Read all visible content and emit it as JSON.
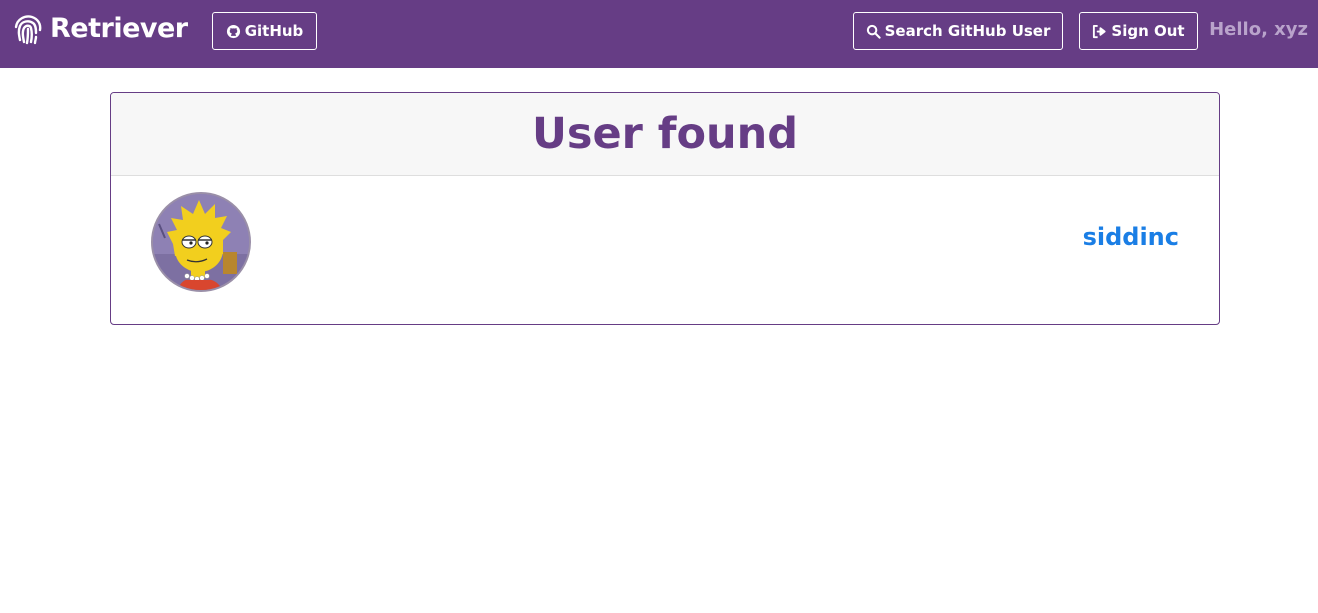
{
  "navbar": {
    "brand": "Retriever",
    "brand_icon": "fingerprint-icon",
    "github_label": "GitHub",
    "github_icon": "github-icon",
    "search_label": "Search GitHub User",
    "search_icon": "search-icon",
    "signout_label": "Sign Out",
    "signout_icon": "sign-out-icon",
    "greeting": "Hello, xyz",
    "background": "#663d85"
  },
  "card": {
    "title": "User found",
    "username": "siddinc",
    "avatar_icon": "user-avatar",
    "title_color": "#663d85",
    "username_color": "#1a7ee5"
  }
}
